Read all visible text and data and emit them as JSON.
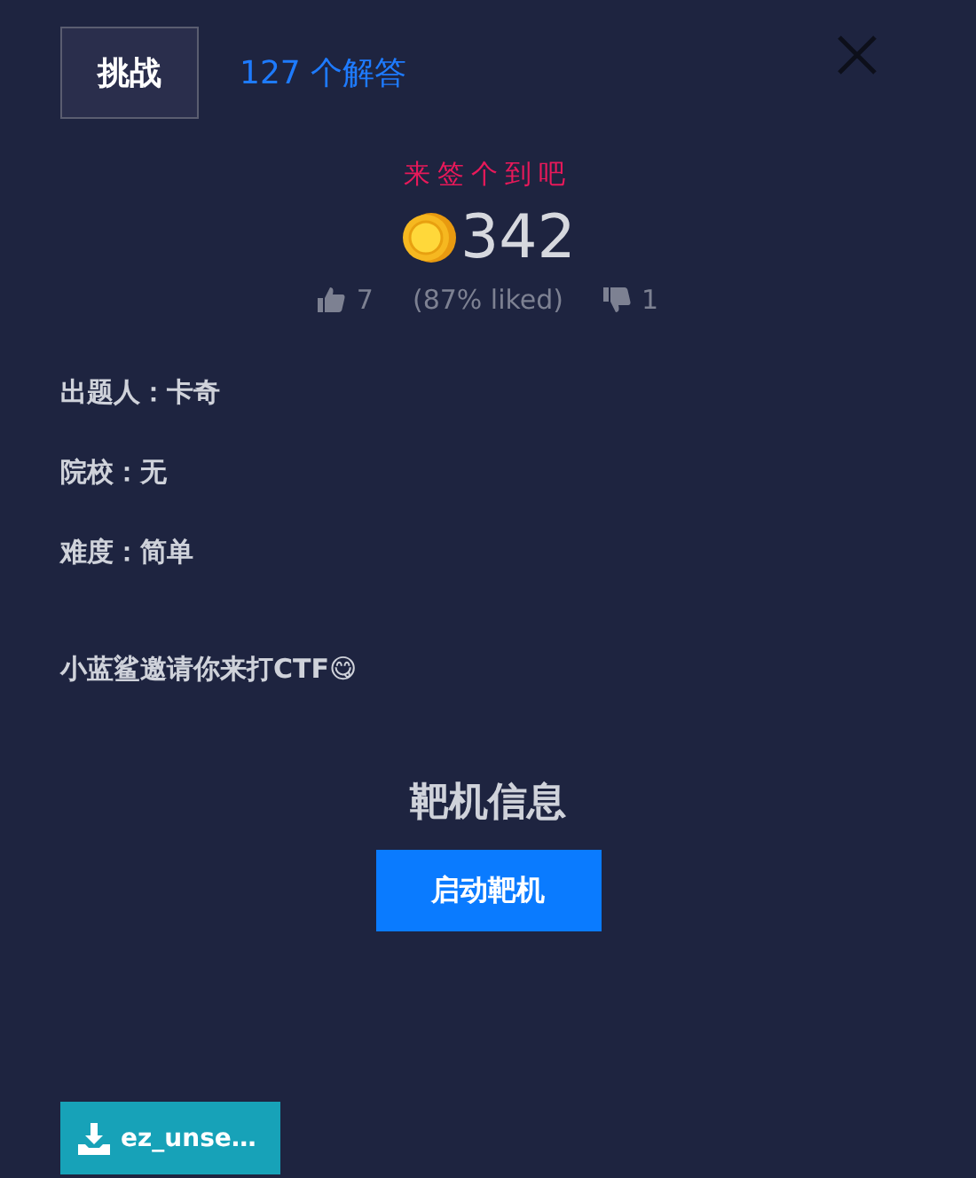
{
  "tabs": [
    {
      "label": "挑战",
      "selected": true
    },
    {
      "label": "127 个解答",
      "selected": false
    }
  ],
  "challenge": {
    "title": "来签个到吧",
    "points": "342",
    "likes": "7",
    "liked_share": "(87% liked)",
    "dislikes": "1"
  },
  "info": [
    "出题人：卡奇",
    "院校：无",
    "难度：简单"
  ],
  "description": "小蓝鲨邀请你来打CTF😋",
  "target": {
    "heading": "靶机信息",
    "button": "启动靶机"
  },
  "files": [
    "ez_unse…"
  ]
}
